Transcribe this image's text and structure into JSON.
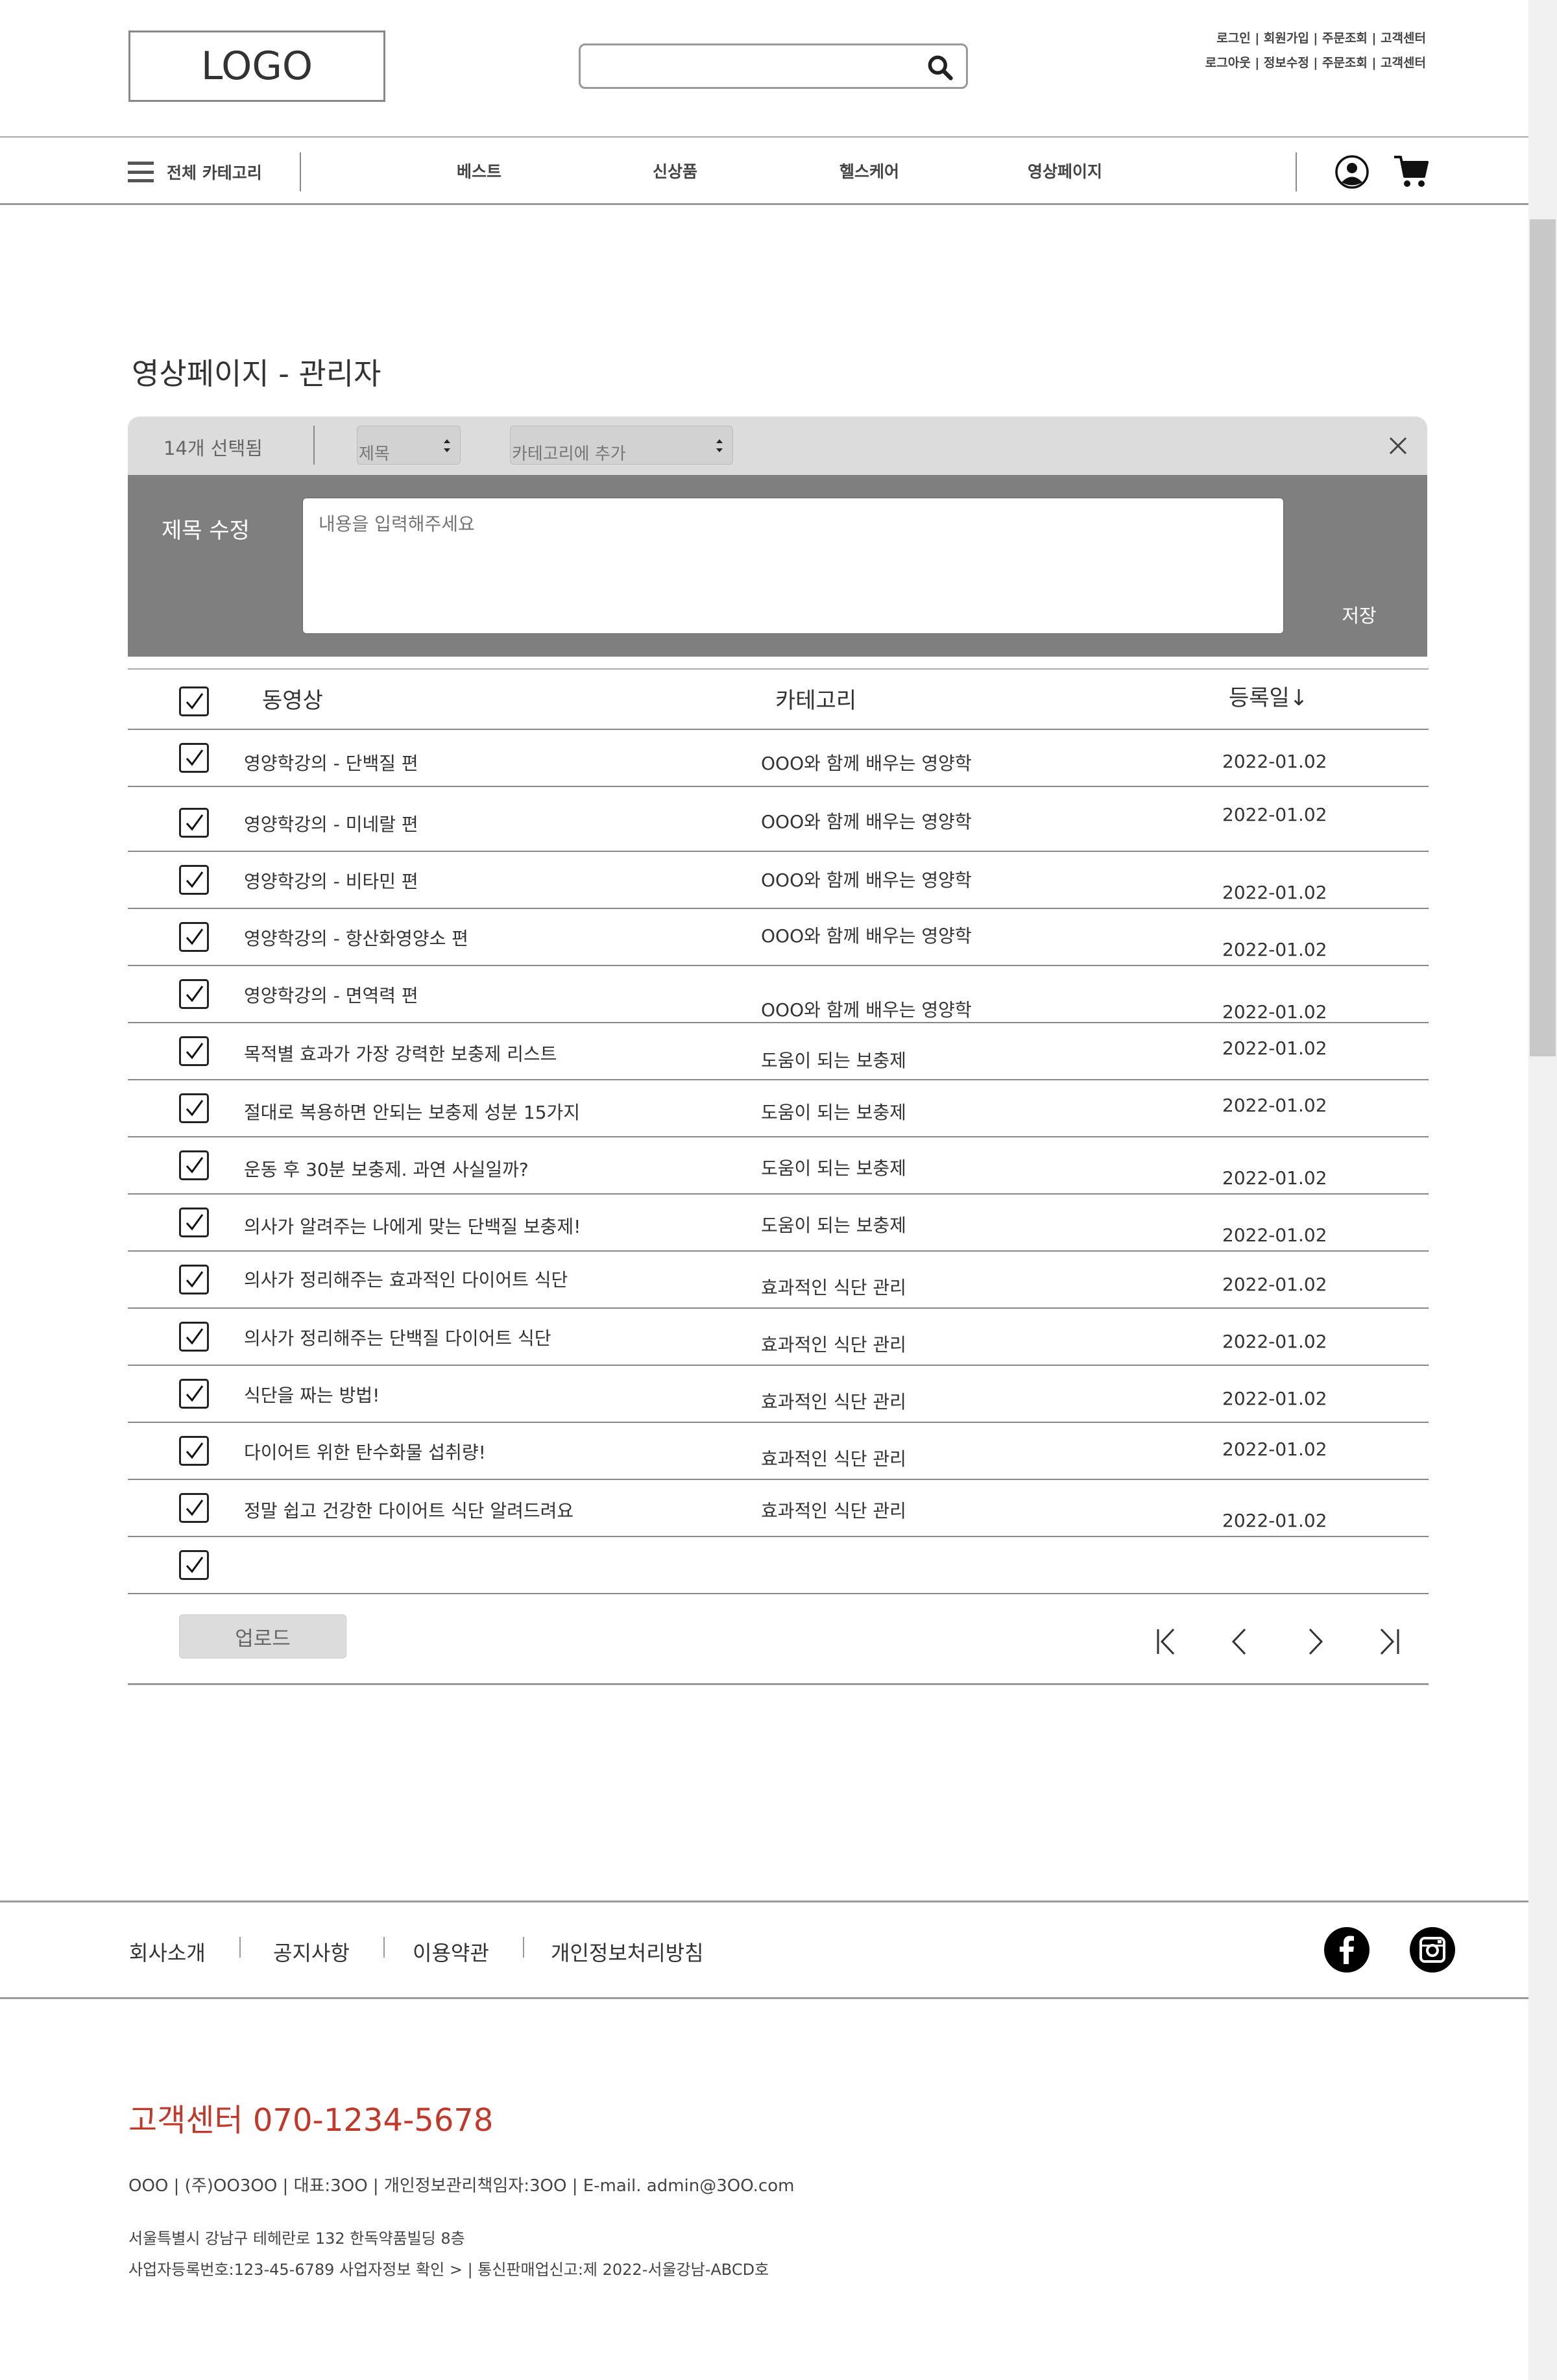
{
  "header": {
    "logo": "LOGO",
    "search_placeholder": "",
    "util_links_1": "로그인 | 회원가입 | 주문조회 | 고객센터",
    "util_links_2": "로그아웃 | 정보수정 | 주문조회 | 고객센터"
  },
  "nav": {
    "all_category": "전체 카테고리",
    "items": [
      "베스트",
      "신상품",
      "헬스케어",
      "영상페이지"
    ]
  },
  "page": {
    "title": "영상페이지 - 관리자"
  },
  "selection_bar": {
    "count_label": "14개 선택됨",
    "title_select": "제목",
    "category_select": "카테고리에 추가"
  },
  "edit_panel": {
    "label": "제목 수정",
    "placeholder": "내용을 입력해주세요",
    "save_label": "저장"
  },
  "table": {
    "headers": {
      "video": "동영상",
      "category": "카테고리",
      "date": "등록일↓"
    },
    "rows": [
      {
        "title": "영양학강의 - 단백질 편",
        "category": "OOO와 함께 배우는 영양학",
        "date": "2022-01.02",
        "checked": true
      },
      {
        "title": "영양학강의 - 미네랄 편",
        "category": "OOO와 함께 배우는 영양학",
        "date": "2022-01.02",
        "checked": true
      },
      {
        "title": "영양학강의 - 비타민 편",
        "category": "OOO와 함께 배우는 영양학",
        "date": "2022-01.02",
        "checked": true
      },
      {
        "title": "영양학강의 - 항산화영양소 편",
        "category": "OOO와 함께 배우는 영양학",
        "date": "2022-01.02",
        "checked": true
      },
      {
        "title": "영양학강의 - 면역력 편",
        "category": "OOO와 함께 배우는 영양학",
        "date": "2022-01.02",
        "checked": true
      },
      {
        "title": "목적별 효과가 가장 강력한 보충제 리스트",
        "category": "도움이 되는 보충제",
        "date": "2022-01.02",
        "checked": true
      },
      {
        "title": "절대로 복용하면 안되는 보충제 성분 15가지",
        "category": "도움이 되는 보충제",
        "date": "2022-01.02",
        "checked": true
      },
      {
        "title": "운동 후 30분 보충제. 과연 사실일까?",
        "category": "도움이 되는 보충제",
        "date": "2022-01.02",
        "checked": true
      },
      {
        "title": "의사가 알려주는 나에게 맞는 단백질 보충제!",
        "category": "도움이 되는 보충제",
        "date": "2022-01.02",
        "checked": true
      },
      {
        "title": "의사가 정리해주는 효과적인 다이어트 식단",
        "category": "효과적인 식단 관리",
        "date": "2022-01.02",
        "checked": true
      },
      {
        "title": "의사가 정리해주는 단백질 다이어트 식단",
        "category": "효과적인 식단 관리",
        "date": "2022-01.02",
        "checked": true
      },
      {
        "title": "식단을 짜는 방법!",
        "category": "효과적인 식단 관리",
        "date": "2022-01.02",
        "checked": true
      },
      {
        "title": "다이어트 위한 탄수화물 섭취량!",
        "category": "효과적인 식단 관리",
        "date": "2022-01.02",
        "checked": true
      },
      {
        "title": "정말 쉽고 건강한 다이어트 식단 알려드려요",
        "category": "효과적인 식단 관리",
        "date": "2022-01.02",
        "checked": true
      },
      {
        "title": "",
        "category": "",
        "date": "",
        "checked": true
      }
    ],
    "upload_label": "업로드"
  },
  "footer": {
    "links": [
      "회사소개",
      "공지사항",
      "이용약관",
      "개인정보처리방침"
    ],
    "cs_title": "고객센터  070-1234-5678",
    "info_line1": "OOO | (주)OO3OO | 대표:3OO | 개인정보관리책임자:3OO | E-mail. admin@3OO.com",
    "info_line2": "서울특별시 강남구 테헤란로 132 한독약품빌딩 8층",
    "info_line3": "사업자등록번호:123-45-6789 사업자정보 확인 > | 통신판매업신고:제 2022-서울강남-ABCD호"
  },
  "colors": {
    "edit_panel_bg": "#7f7f7f",
    "selection_bar_bg": "#dcdcdc",
    "cs_accent": "#c0392b"
  }
}
